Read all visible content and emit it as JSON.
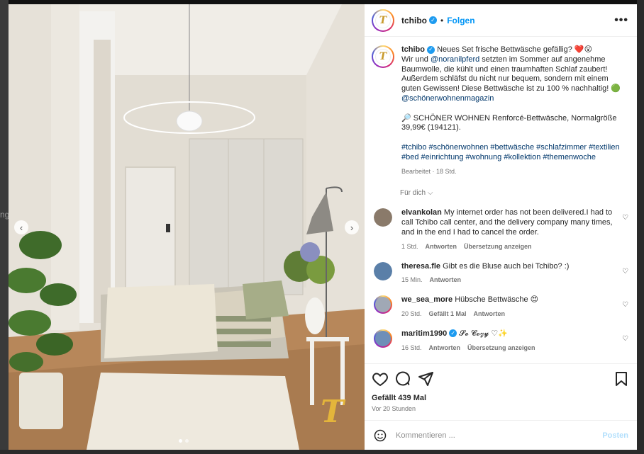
{
  "backdrop": {
    "side_text": "ng"
  },
  "post": {
    "username": "tchibo",
    "follow_label": "Folgen",
    "separator": "•",
    "more_icon": "more-horizontal-icon",
    "avatar_letter": "T"
  },
  "caption": {
    "username": "tchibo",
    "text_1": "Neues Set frische Bettwäsche gefällig? ❤️😲",
    "text_2a": "Wir und ",
    "mention_1": "@noranilpferd",
    "text_2b": " setzten im Sommer auf angenehme Baumwolle, die kühlt und einen traumhaften Schlaf zaubert! Außerdem schläfst du nicht nur bequem, sondern mit einem guten Gewissen! Diese Bettwäsche ist zu 100 % nachhaltig! 🟢",
    "mention_2": "@schönerwohnenmagazin",
    "product": "🔎 SCHÖNER WOHNEN Renforcé-Bettwäsche, Normalgröße 39,99€ (194121).",
    "hashtags": "#tchibo #schönerwohnen #bettwäsche #schlafzimmer #textilien #bed #einrichtung #wohnung #kollektion #themenwoche",
    "meta": "Bearbeitet · 18 Std."
  },
  "see_translation": "Für dich ⌵",
  "comments": [
    {
      "username": "elvankolan",
      "text": "My internet order has not been delivered.I had to call Tchibo call center, and the delivery company many times, and in the end I had to cancel the order.",
      "time": "1 Std.",
      "reply": "Antworten",
      "translate": "Übersetzung anzeigen",
      "avatar_color": "#8a7a6a"
    },
    {
      "username": "theresa.fle",
      "text": "Gibt es die Bluse auch bei Tchibo? :)",
      "time": "15 Min.",
      "reply": "Antworten",
      "avatar_color": "#5a7fa8"
    },
    {
      "username": "we_sea_more",
      "text": "Hübsche Bettwäsche 😍",
      "time": "20 Std.",
      "likes": "Gefällt 1 Mal",
      "reply": "Antworten",
      "avatar_color": "#a0a8b5"
    },
    {
      "username": "maritim1990",
      "text": "𝓢𝓸 𝓒𝓸𝔃𝔂 ♡✨",
      "time": "16 Std.",
      "reply": "Antworten",
      "translate": "Übersetzung anzeigen",
      "avatar_color": "#6f8fb8"
    }
  ],
  "actions": {
    "likes": "Gefällt 439 Mal",
    "date": "Vor 20 Stunden"
  },
  "comment_bar": {
    "placeholder": "Kommentieren ...",
    "post_label": "Posten"
  },
  "colors": {
    "accent_blue": "#0095f6",
    "link": "#00376b",
    "muted": "#737373"
  }
}
